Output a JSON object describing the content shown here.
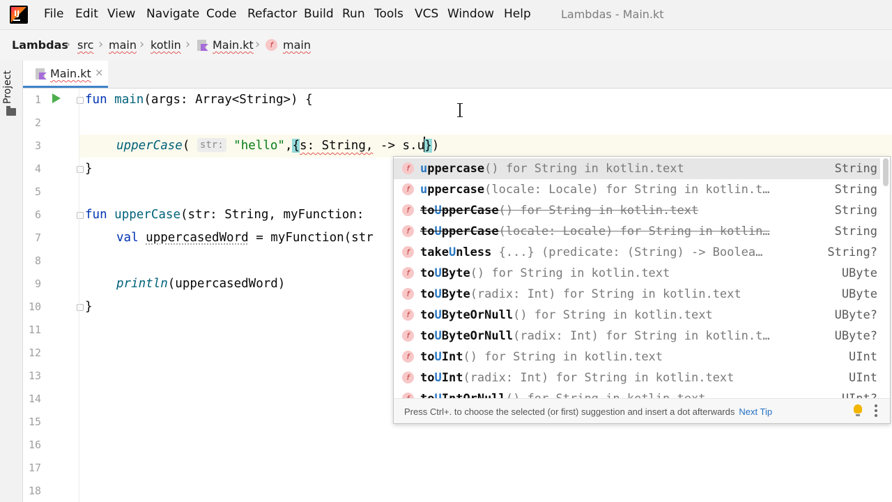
{
  "menu": {
    "items": [
      "File",
      "Edit",
      "View",
      "Navigate",
      "Code",
      "Refactor",
      "Build",
      "Run",
      "Tools",
      "VCS",
      "Window",
      "Help"
    ],
    "window_title": "Lambdas - Main.kt"
  },
  "breadcrumb": {
    "project": "Lambdas",
    "src": "src",
    "main_dir": "main",
    "kotlin": "kotlin",
    "file": "Main.kt",
    "function": "main"
  },
  "tool_window": {
    "project_label": "Project"
  },
  "editor_tab": {
    "label": "Main.kt",
    "close": "×"
  },
  "line_numbers": [
    "1",
    "2",
    "3",
    "4",
    "5",
    "6",
    "7",
    "8",
    "9",
    "10",
    "11",
    "12",
    "13",
    "14",
    "15",
    "16",
    "17",
    "18"
  ],
  "code": {
    "l1_fun": "fun ",
    "l1_name": "main",
    "l1_rest": "(args: Array<String>) {",
    "l3_call": "upperCase",
    "l3_paren": "( ",
    "l3_hint": "str:",
    "l3_str": "\"hello\"",
    "l3_comma": ",",
    "l3_brace": "{",
    "l3_lambda": "s: String,",
    "l3_arrow": " -> s.u",
    "l3_close_brace": "}",
    "l3_close_paren": ")",
    "l4": "}",
    "l6_fun": "fun ",
    "l6_name": "upperCase",
    "l6_rest": "(str: String, myFunction:",
    "l7_val": "val ",
    "l7_var": "uppercasedWord",
    "l7_rest": " = myFunction(str",
    "l9_call": "println",
    "l9_rest": "(uppercasedWord)",
    "l10": "}"
  },
  "completion": {
    "items": [
      {
        "match": "u",
        "rest": "ppercase",
        "sig": "() for String in kotlin.text",
        "type": "String",
        "selected": true,
        "deprecated": false
      },
      {
        "match": "u",
        "rest": "ppercase",
        "sig": "(locale: Locale) for String in kotlin.t…",
        "type": "String",
        "selected": false,
        "deprecated": false
      },
      {
        "pre": "to",
        "match": "U",
        "rest": "pperCase",
        "sig": "() for String in kotlin.text",
        "type": "String",
        "selected": false,
        "deprecated": true
      },
      {
        "pre": "to",
        "match": "U",
        "rest": "pperCase",
        "sig": "(locale: Locale) for String in kotlin…",
        "type": "String",
        "selected": false,
        "deprecated": true
      },
      {
        "pre": "take",
        "match": "U",
        "rest": "nless",
        "sig": " {...} (predicate: (String) -> Boolea…",
        "type": "String?",
        "selected": false,
        "deprecated": false
      },
      {
        "pre": "to",
        "match": "U",
        "rest": "Byte",
        "sig": "() for String in kotlin.text",
        "type": "UByte",
        "selected": false,
        "deprecated": false
      },
      {
        "pre": "to",
        "match": "U",
        "rest": "Byte",
        "sig": "(radix: Int) for String in kotlin.text",
        "type": "UByte",
        "selected": false,
        "deprecated": false
      },
      {
        "pre": "to",
        "match": "U",
        "rest": "ByteOrNull",
        "sig": "() for String in kotlin.text",
        "type": "UByte?",
        "selected": false,
        "deprecated": false
      },
      {
        "pre": "to",
        "match": "U",
        "rest": "ByteOrNull",
        "sig": "(radix: Int) for String in kotlin.t…",
        "type": "UByte?",
        "selected": false,
        "deprecated": false
      },
      {
        "pre": "to",
        "match": "U",
        "rest": "Int",
        "sig": "() for String in kotlin.text",
        "type": "UInt",
        "selected": false,
        "deprecated": false
      },
      {
        "pre": "to",
        "match": "U",
        "rest": "Int",
        "sig": "(radix: Int) for String in kotlin.text",
        "type": "UInt",
        "selected": false,
        "deprecated": false
      },
      {
        "pre": "to",
        "match": "U",
        "rest": "IntOrNull",
        "sig": "() for String in kotlin.text",
        "type": "UInt?",
        "selected": false,
        "deprecated": false
      }
    ],
    "kind_icon": "f",
    "footer_text": "Press Ctrl+. to choose the selected (or first) suggestion and insert a dot afterwards",
    "next_tip": "Next Tip"
  },
  "icons": {
    "app": "intellij-logo-icon",
    "function": "function-icon",
    "file": "kotlin-file-icon",
    "run": "run-icon",
    "bulb": "lightbulb-icon",
    "more": "more-vertical-icon"
  },
  "colors": {
    "accent": "#4083c9",
    "keyword": "#0033b3",
    "function": "#00627a",
    "string": "#067d17",
    "selection": "#e6e6e6"
  }
}
